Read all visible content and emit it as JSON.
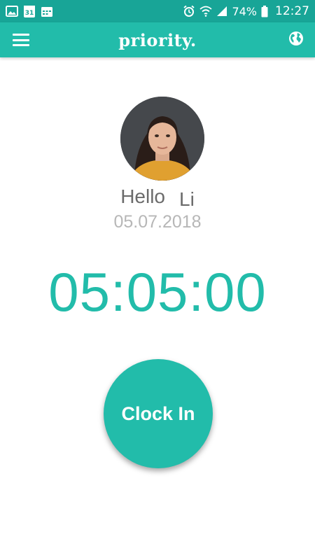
{
  "status_bar": {
    "calendar_day": "31",
    "battery_percent": "74%",
    "time": "12:27",
    "icons": [
      "gallery-icon",
      "calendar-icon",
      "calendar-grid-icon",
      "alarm-icon",
      "wifi-icon",
      "signal-icon",
      "battery-icon"
    ]
  },
  "app_bar": {
    "brand": "priority.",
    "menu_icon": "hamburger-icon",
    "language_icon": "globe-icon"
  },
  "user": {
    "greeting": "Hello",
    "name": "Li",
    "date": "05.07.2018"
  },
  "timer": {
    "value": "05:05:00"
  },
  "actions": {
    "clock_in_label": "Clock In"
  },
  "colors": {
    "primary": "#22bcaa",
    "status_bar": "#18a597",
    "greeting_text": "#6b6b6b",
    "date_text": "#b7b7b7"
  }
}
